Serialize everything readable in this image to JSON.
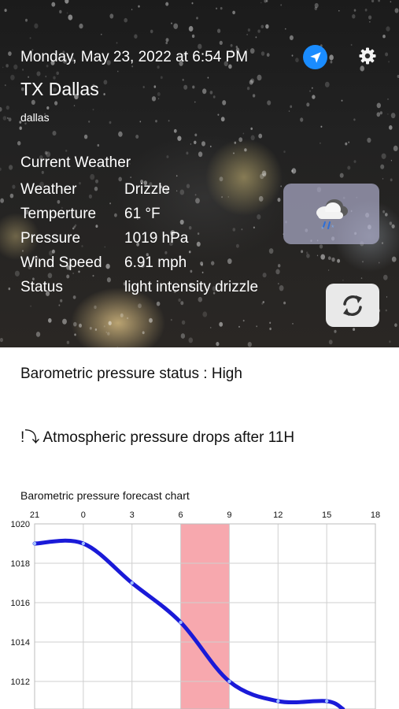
{
  "header": {
    "datetime": "Monday, May 23, 2022 at 6:54 PM",
    "city": "TX Dallas",
    "city_query": "dallas"
  },
  "current": {
    "heading": "Current Weather",
    "rows": [
      {
        "label": "Weather",
        "value": "Drizzle"
      },
      {
        "label": "Temperture",
        "value": "61 °F"
      },
      {
        "label": "Pressure",
        "value": "1019 hPa"
      },
      {
        "label": "Wind Speed",
        "value": "6.91 mph"
      },
      {
        "label": "Status",
        "value": "light intensity drizzle"
      }
    ],
    "icon": "cloud-rain-snow-icon"
  },
  "icons": {
    "location": "location-arrow-icon",
    "settings": "gear-icon",
    "refresh": "refresh-icon"
  },
  "colors": {
    "location_button": "#1a8cff",
    "weather_card": "#aaaac8",
    "line": "#1a1ad8",
    "highlight": "#f7a8ae"
  },
  "pressure_status": "Barometric pressure status : High",
  "pressure_trend": "!⤵ Atmospheric pressure drops after 11H",
  "chart_data": {
    "type": "line",
    "title": "Barometric pressure forecast chart",
    "x_tick_labels": [
      "21",
      "0",
      "3",
      "6",
      "9",
      "12",
      "15",
      "18"
    ],
    "y_tick_labels": [
      "1020",
      "1018",
      "1016",
      "1014",
      "1012"
    ],
    "ylim": [
      1010.6,
      1020
    ],
    "grid": true,
    "highlight_band": {
      "from": "6",
      "to": "9"
    },
    "series": [
      {
        "x": [
          "21",
          "0",
          "3",
          "6",
          "9",
          "12",
          "15",
          "16"
        ],
        "values": [
          1019.0,
          1019.0,
          1017.0,
          1015.0,
          1012.0,
          1011.0,
          1011.0,
          1010.6
        ]
      }
    ]
  }
}
